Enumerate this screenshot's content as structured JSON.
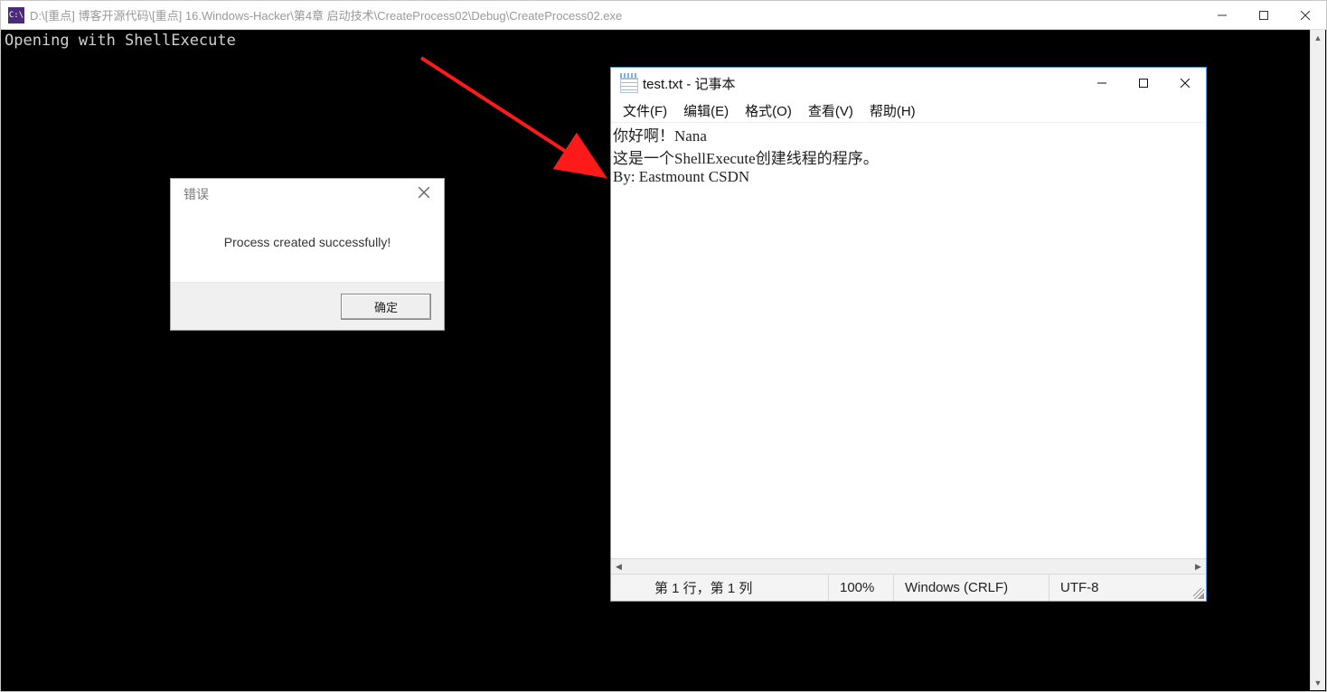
{
  "console": {
    "icon_text": "C:\\",
    "title": "D:\\[重点] 博客开源代码\\[重点] 16.Windows-Hacker\\第4章 启动技术\\CreateProcess02\\Debug\\CreateProcess02.exe",
    "output_line1": "Opening with ShellExecute"
  },
  "dialog": {
    "title": "错误",
    "body": "Process created successfully!",
    "ok_label": "确定"
  },
  "notepad": {
    "title": "test.txt - 记事本",
    "menu": {
      "file": "文件(F)",
      "edit": "编辑(E)",
      "format": "格式(O)",
      "view": "查看(V)",
      "help": "帮助(H)"
    },
    "content_line1": "你好啊！Nana",
    "content_line2": "这是一个ShellExecute创建线程的程序。",
    "content_line3": "By: Eastmount CSDN",
    "status": {
      "position": "第 1 行，第 1 列",
      "zoom": "100%",
      "eol": "Windows (CRLF)",
      "encoding": "UTF-8"
    }
  }
}
